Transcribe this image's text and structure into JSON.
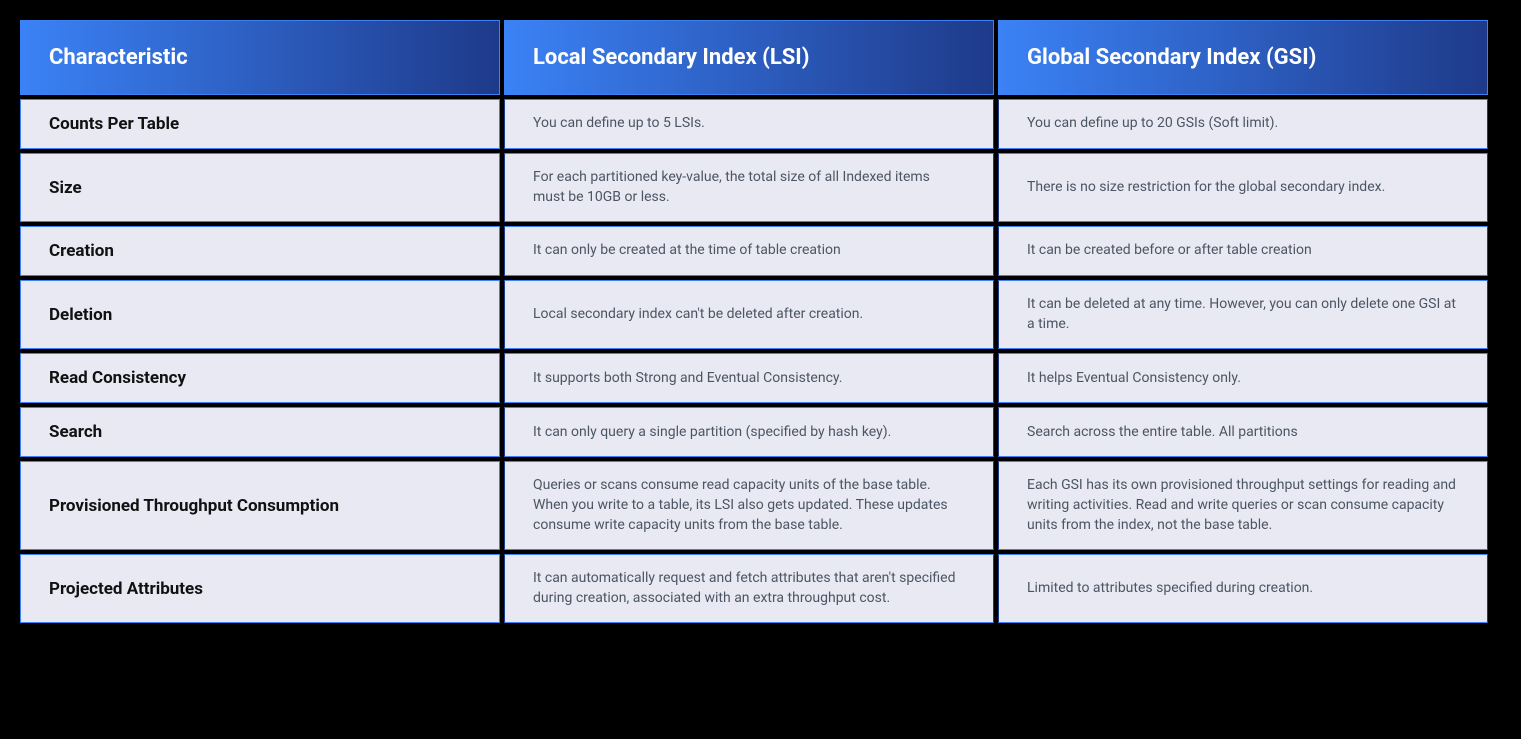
{
  "table": {
    "headers": {
      "characteristic": "Characteristic",
      "lsi": "Local Secondary Index (LSI)",
      "gsi": "Global Secondary Index (GSI)"
    },
    "rows": [
      {
        "name": "Counts Per Table",
        "lsi": "You can define up to 5 LSIs.",
        "gsi": "You can define up to 20 GSIs (Soft limit)."
      },
      {
        "name": "Size",
        "lsi": "For each partitioned key-value, the total size of all Indexed items must be 10GB or less.",
        "gsi": "There is no size restriction for the global secondary index."
      },
      {
        "name": "Creation",
        "lsi": "It can only be created at the time of table creation",
        "gsi": "It can be created before or after table creation"
      },
      {
        "name": "Deletion",
        "lsi": "Local secondary index can't be deleted after creation.",
        "gsi": "It can be deleted at any time. However, you can only delete one GSI at a time."
      },
      {
        "name": "Read Consistency",
        "lsi": "It supports both Strong and Eventual Consistency.",
        "gsi": "It helps Eventual Consistency only."
      },
      {
        "name": "Search",
        "lsi": "It can only query a single partition (specified by hash key).",
        "gsi": "Search across the entire table. All partitions"
      },
      {
        "name": "Provisioned Throughput Consumption",
        "lsi": "Queries or scans consume read capacity units of the base table. When you write to a table, its LSI also gets updated. These updates consume write capacity units from the base table.",
        "gsi": "Each GSI has its own provisioned throughput settings for reading and writing activities. Read and write queries or scan consume capacity units from the index, not the base table."
      },
      {
        "name": "Projected Attributes",
        "lsi": "It can automatically request and fetch attributes that aren't specified during creation, associated with an extra throughput cost.",
        "gsi": "Limited to attributes specified during creation."
      }
    ]
  }
}
